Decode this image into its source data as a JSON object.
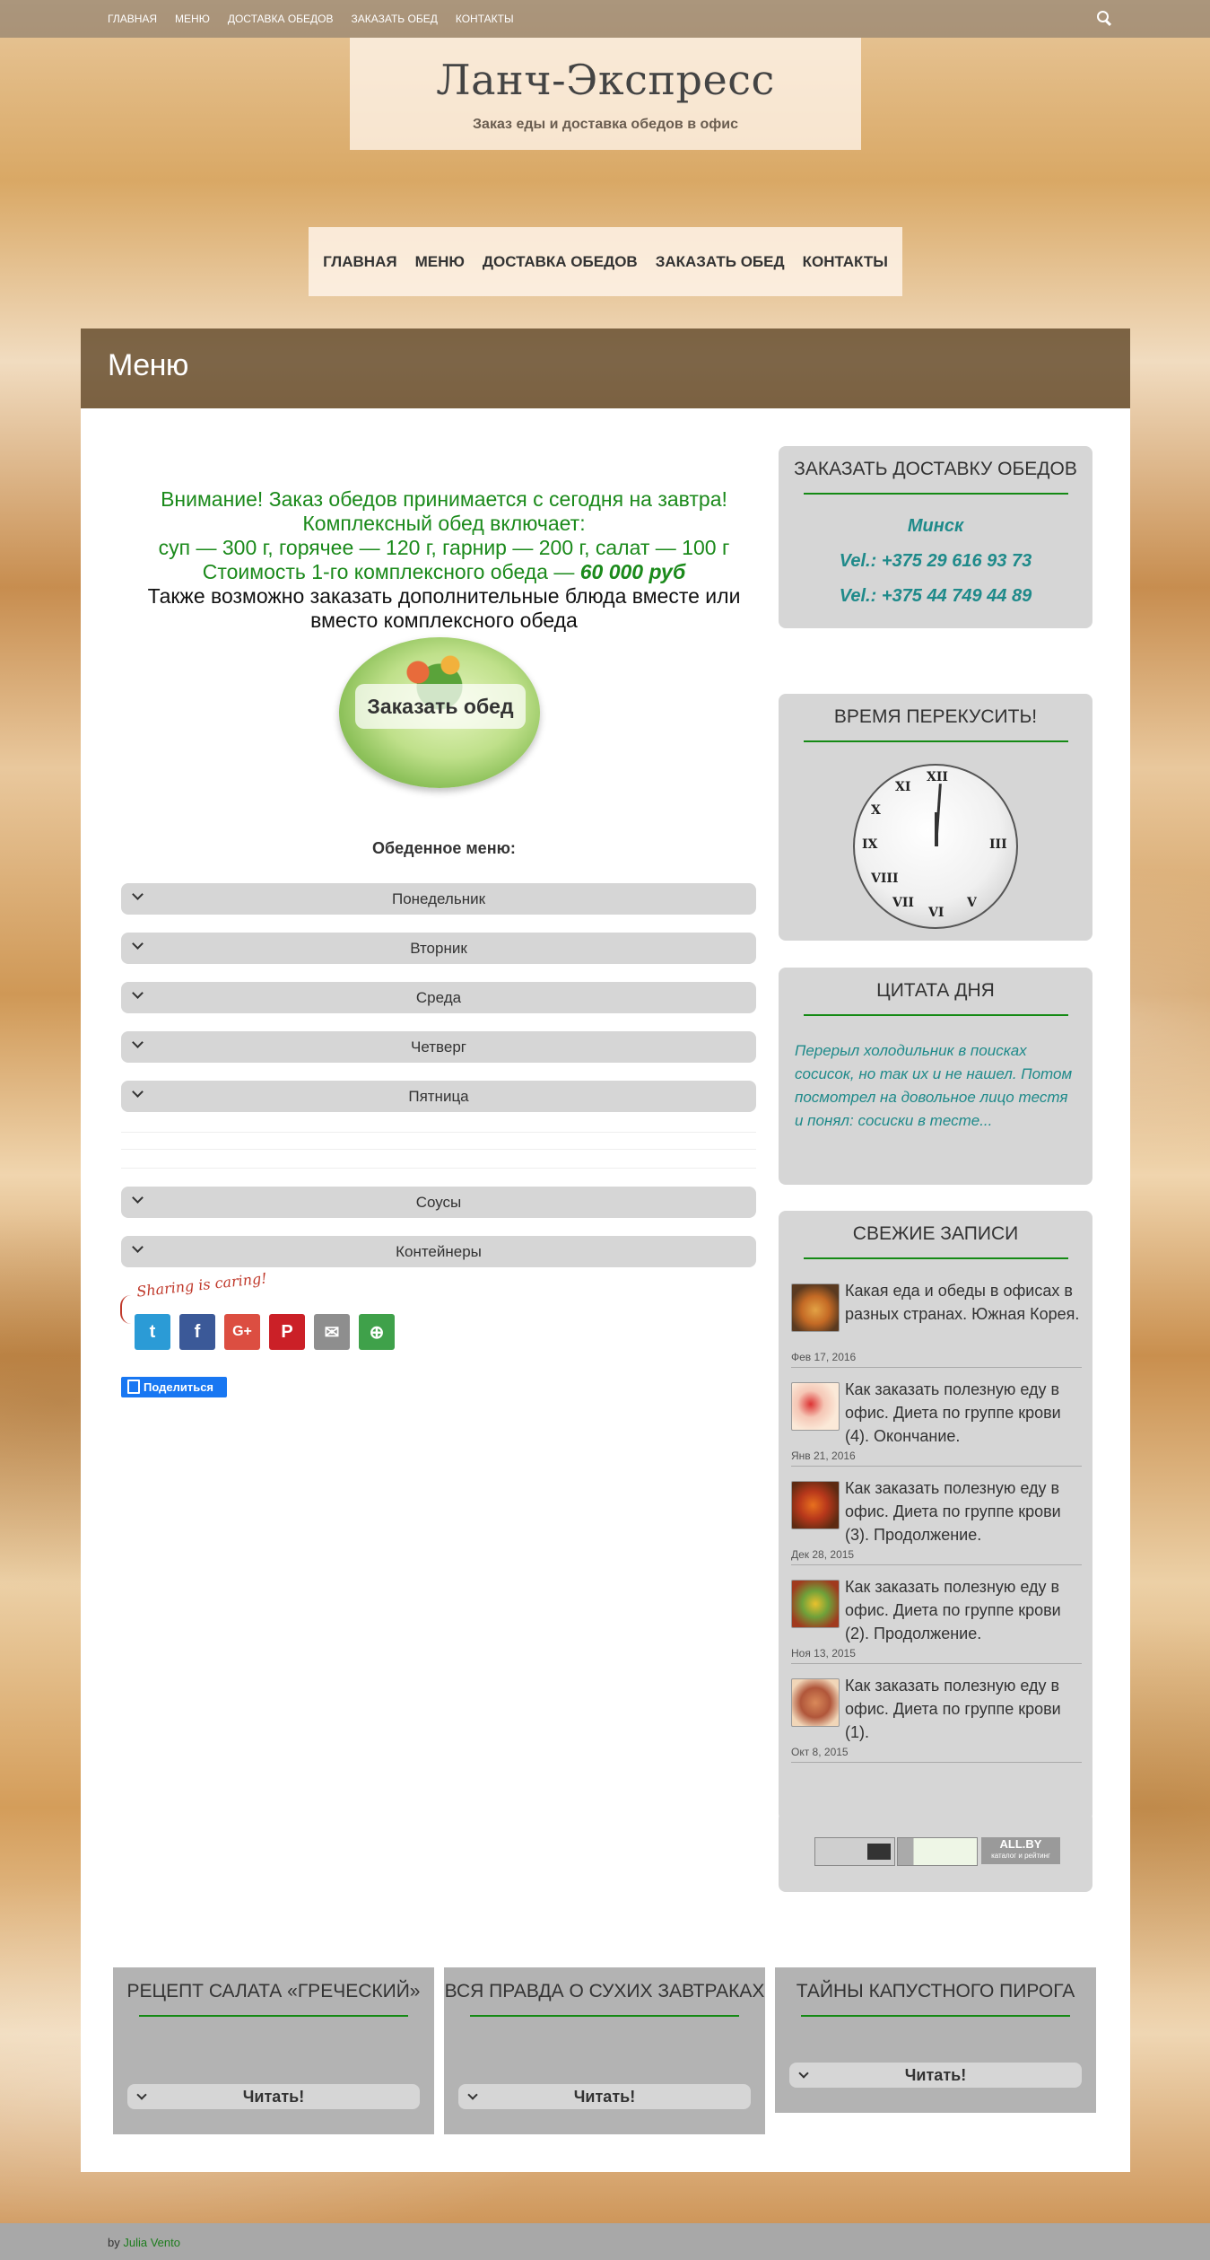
{
  "topnav": [
    "ГЛАВНАЯ",
    "МЕНЮ",
    "ДОСТАВКА ОБЕДОВ",
    "ЗАКАЗАТЬ ОБЕД",
    "КОНТАКТЫ"
  ],
  "site": {
    "title": "Ланч-Экспресс",
    "description": "Заказ еды и доставка обедов в офис"
  },
  "mainnav": [
    "ГЛАВНАЯ",
    "МЕНЮ",
    "ДОСТАВКА ОБЕДОВ",
    "ЗАКАЗАТЬ ОБЕД",
    "КОНТАКТЫ"
  ],
  "page": {
    "title": "Меню"
  },
  "intro": {
    "line1": "Внимание! Заказ обедов принимается с сегодня на завтра!",
    "line2": "Комплексный обед включает:",
    "line3": "суп — 300 г, горячее — 120 г, гарнир — 200 г, салат — 100 г",
    "line4_prefix": "Стоимость 1-го комплексного обеда — ",
    "line4_price": "60 000 руб",
    "line5": "Также возможно заказать дополнительные блюда вместе или вместо комплексного обеда"
  },
  "order_button": "Заказать обед",
  "menu_title": "Обеденное меню:",
  "accordion": [
    "Понедельник",
    "Вторник",
    "Среда",
    "Четверг",
    "Пятница",
    "Соусы",
    "Контейнеры"
  ],
  "share": {
    "caption": "Sharing is caring!",
    "buttons": [
      {
        "icon": "twitter-icon",
        "glyph": "t",
        "color": "#2b9bd6"
      },
      {
        "icon": "facebook-icon",
        "glyph": "f",
        "color": "#3b5998"
      },
      {
        "icon": "google-plus-icon",
        "glyph": "G+",
        "color": "#dc4e41"
      },
      {
        "icon": "pinterest-icon",
        "glyph": "P",
        "color": "#cb2027"
      },
      {
        "icon": "email-icon",
        "glyph": "✉",
        "color": "#8e8e8e"
      },
      {
        "icon": "more-icon",
        "glyph": "⊕",
        "color": "#3fa14a"
      }
    ],
    "fb_label": "Поделиться"
  },
  "sidebar": {
    "delivery": {
      "title": "ЗАКАЗАТЬ ДОСТАВКУ ОБЕДОВ",
      "city": "Минск",
      "phone1": "Vel.: +375 29 616 93 73",
      "phone2": "Vel.: +375 44 749 44 89"
    },
    "clock": {
      "title": "ВРЕМЯ ПЕРЕКУСИТЬ!"
    },
    "quote": {
      "title": "ЦИТАТА ДНЯ",
      "text": "Перерыл холодильник в поисках сосисок, но так их и не нашел. Потом посмотрел на довольное лицо тестя и понял: сосиски в тесте..."
    },
    "recent": {
      "title": "СВЕЖИЕ ЗАПИСИ",
      "posts": [
        {
          "title": "Какая еда и обеды в офисах в разных странах. Южная Корея.",
          "date": "Фев 17, 2016"
        },
        {
          "title": "Как заказать полезную еду в офис. Диета по группе крови (4). Окончание.",
          "date": "Янв 21, 2016"
        },
        {
          "title": "Как заказать полезную еду в офис. Диета по группе крови (3). Продолжение.",
          "date": "Дек 28, 2015"
        },
        {
          "title": "Как заказать полезную еду в офис. Диета по группе крови (2). Продолжение.",
          "date": "Ноя 13, 2015"
        },
        {
          "title": "Как заказать полезную еду в офис. Диета по группе крови (1).",
          "date": "Окт 8, 2015"
        }
      ]
    },
    "counter": {
      "label": "ALL.BY",
      "sub": "каталог и рейтинг"
    }
  },
  "footer_boxes": [
    {
      "title": "РЕЦЕПТ САЛАТА «ГРЕЧЕСКИЙ»",
      "button": "Читать!"
    },
    {
      "title": "ВСЯ ПРАВДА О СУХИХ ЗАВТРАКАХ",
      "button": "Читать!"
    },
    {
      "title": "ТАЙНЫ КАПУСТНОГО ПИРОГА",
      "button": "Читать!"
    }
  ],
  "credit": {
    "prefix": "by ",
    "author": "Julia Vento"
  }
}
